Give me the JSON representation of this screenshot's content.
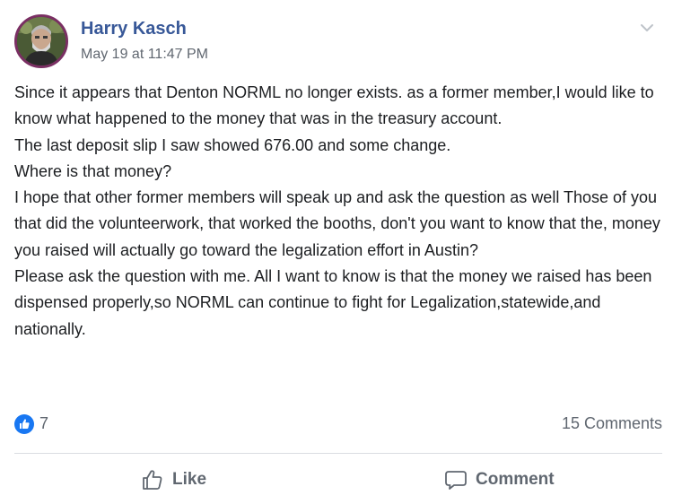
{
  "post": {
    "author": "Harry Kasch",
    "timestamp": "May 19 at 11:47 PM",
    "body_lines": [
      "Since it appears that Denton NORML no longer exists. as a former member,I would like to know what happened to the money that was in the treasury account.",
      "The last deposit slip I saw showed 676.00 and some change.",
      "Where is that money?",
      "I hope that other former members will speak up and ask the question as well Those of you that did the volunteerwork, that worked the booths, don't you want to know that the, money you raised will actually go toward the legalization effort in Austin?",
      "Please ask the question with me. All I want to know is that the money we raised has been dispensed properly,so NORML can continue to fight for Legalization,statewide,and nationally."
    ]
  },
  "stats": {
    "like_count": "7",
    "comments": "15 Comments"
  },
  "actions": {
    "like_label": "Like",
    "comment_label": "Comment"
  },
  "icons": {
    "options": "chevron-down-icon",
    "like_reaction": "thumbs-up-icon",
    "like_action": "thumbs-up-outline-icon",
    "comment_action": "speech-bubble-icon"
  },
  "colors": {
    "author": "#385898",
    "secondary_text": "#606770",
    "like_blue": "#1877f2",
    "avatar_border": "#7a2f63"
  }
}
